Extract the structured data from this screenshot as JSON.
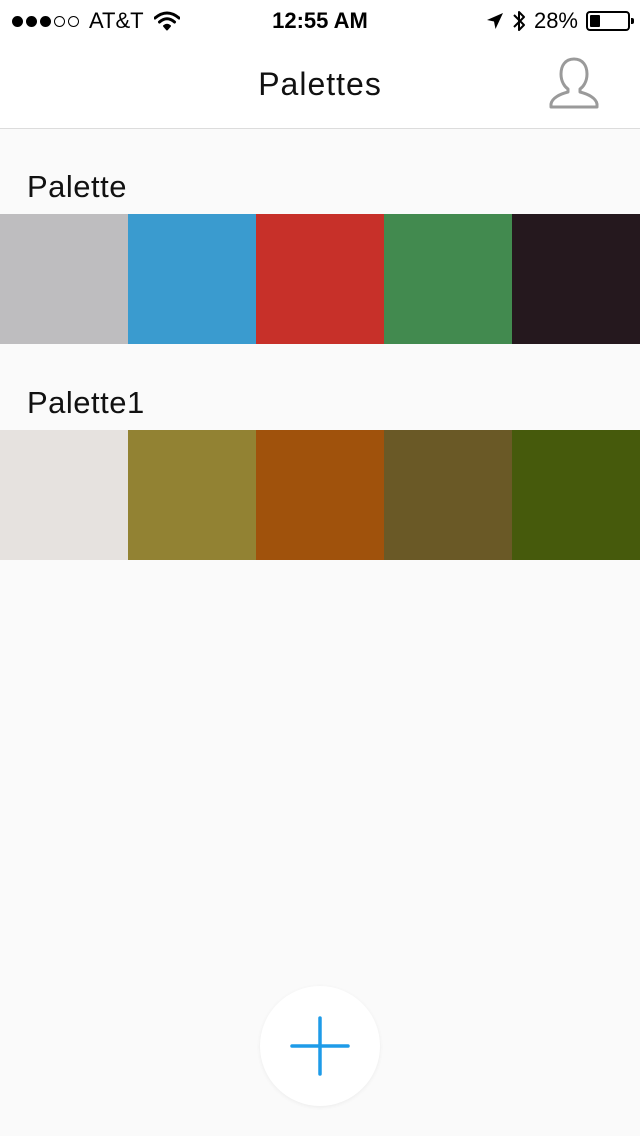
{
  "status_bar": {
    "carrier": "AT&T",
    "time": "12:55 AM",
    "battery_percent": "28%",
    "battery_level": 0.28,
    "signal_bars_filled": 3,
    "signal_bars_total": 5,
    "icons": [
      "wifi-icon",
      "location-arrow-icon",
      "bluetooth-icon",
      "battery-icon"
    ]
  },
  "nav": {
    "title": "Palettes",
    "profile_icon": "user-profile-icon"
  },
  "palettes": [
    {
      "name": "Palette",
      "colors": [
        "#bebdbf",
        "#3a9bcf",
        "#c73029",
        "#428a4f",
        "#25181e"
      ]
    },
    {
      "name": "Palette1",
      "colors": [
        "#e6e2df",
        "#928233",
        "#a0520c",
        "#6a5926",
        "#465a0c"
      ]
    }
  ],
  "add_button": {
    "icon": "plus-icon",
    "color": "#1e9be8"
  },
  "theme": {
    "background": "#fafafa",
    "bar_background": "#ffffff",
    "icon_gray": "#9a9a9a"
  }
}
